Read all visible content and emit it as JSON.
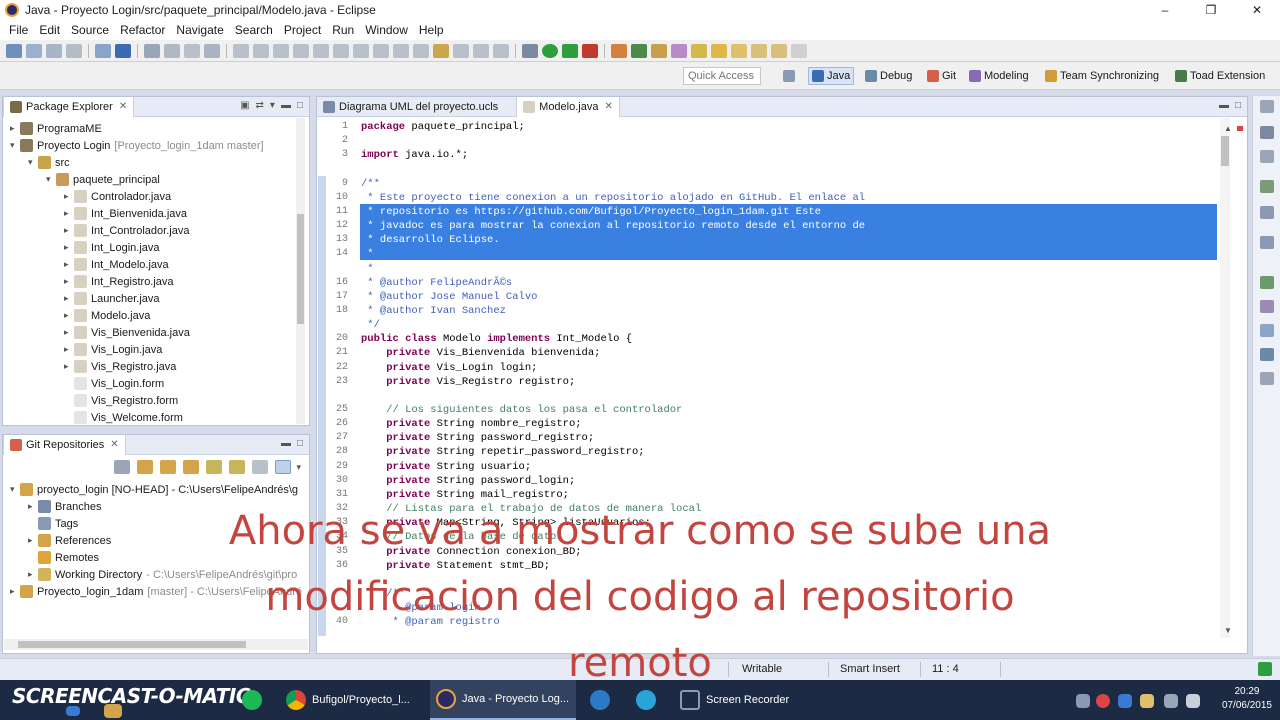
{
  "window": {
    "title": "Java - Proyecto Login/src/paquete_principal/Modelo.java - Eclipse"
  },
  "menu": [
    "File",
    "Edit",
    "Source",
    "Refactor",
    "Navigate",
    "Search",
    "Project",
    "Run",
    "Window",
    "Help"
  ],
  "quick_access": {
    "placeholder": "Quick Access"
  },
  "perspectives": [
    {
      "label": "Java",
      "active": true
    },
    {
      "label": "Debug"
    },
    {
      "label": "Git"
    },
    {
      "label": "Modeling"
    },
    {
      "label": "Team Synchronizing"
    },
    {
      "label": "Toad Extension"
    }
  ],
  "package_explorer": {
    "title": "Package Explorer",
    "items": [
      {
        "label": "ProgramaME"
      },
      {
        "label": "Proyecto Login",
        "detail": "[Proyecto_login_1dam master]"
      },
      {
        "label": "src"
      },
      {
        "label": "paquete_principal"
      },
      {
        "label": "Controlador.java"
      },
      {
        "label": "Int_Bienvenida.java"
      },
      {
        "label": "Int_Controlador.java"
      },
      {
        "label": "Int_Login.java"
      },
      {
        "label": "Int_Modelo.java"
      },
      {
        "label": "Int_Registro.java"
      },
      {
        "label": "Launcher.java"
      },
      {
        "label": "Modelo.java"
      },
      {
        "label": "Vis_Bienvenida.java"
      },
      {
        "label": "Vis_Login.java"
      },
      {
        "label": "Vis_Registro.java"
      },
      {
        "label": "Vis_Login.form"
      },
      {
        "label": "Vis_Registro.form"
      },
      {
        "label": "Vis_Welcome.form"
      }
    ]
  },
  "git_repositories": {
    "title": "Git Repositories",
    "items": [
      {
        "label": "proyecto_login [NO-HEAD] - C:\\Users\\FelipeAndrés\\g"
      },
      {
        "label": "Branches"
      },
      {
        "label": "Tags"
      },
      {
        "label": "References"
      },
      {
        "label": "Remotes"
      },
      {
        "label": "Working Directory",
        "detail": "- C:\\Users\\FelipeAndrés\\git\\pro"
      },
      {
        "label": "Proyecto_login_1dam",
        "detail": "[master] - C:\\Users\\FelipeAndré"
      }
    ]
  },
  "editor": {
    "tabs": [
      {
        "label": "Diagrama UML del proyecto.ucls"
      },
      {
        "label": "Modelo.java",
        "active": true
      }
    ],
    "line_numbers": [
      "1",
      "2",
      "3",
      "",
      "9",
      "10",
      "11",
      "12",
      "13",
      "14",
      "",
      "16",
      "17",
      "18",
      "",
      "20",
      "21",
      "22",
      "23",
      "",
      "25",
      "26",
      "27",
      "28",
      "29",
      "30",
      "31",
      "32",
      "33",
      "34",
      "35",
      "36",
      "",
      "",
      "",
      "40"
    ],
    "lines": [
      "package paquete_principal;",
      "",
      "import java.io.*;",
      "",
      "/**",
      " * Este proyecto tiene conexion a un repositorio alojado en GitHub. El enlace al",
      " * repositorio es https://github.com/Bufigol/Proyecto_login_1dam.git Este",
      " * javadoc es para mostrar la conexion al repositorio remoto desde el entorno de",
      " * desarrollo Eclipse.",
      " *",
      " *",
      " * @author FelipeAndrÃ©s",
      " * @author Jose Manuel Calvo",
      " * @author Ivan Sanchez",
      " */",
      "public class Modelo implements Int_Modelo {",
      "    private Vis_Bienvenida bienvenida;",
      "    private Vis_Login login;",
      "    private Vis_Registro registro;",
      "",
      "    // Los siguientes datos los pasa el controlador",
      "    private String nombre_registro;",
      "    private String password_registro;",
      "    private String repetir_password_registro;",
      "    private String usuario;",
      "    private String password_login;",
      "    private String mail_registro;",
      "    // Listas para el trabajo de datos de manera local",
      "    private Map<String, String> listaUsuarios;",
      "    // Datos de la base de datos",
      "    private Connection conexion_BD;",
      "    private Statement stmt_BD;",
      "",
      "    /**",
      "     * @param login",
      "     * @param registro"
    ]
  },
  "status": {
    "mode": "Writable",
    "insert": "Smart Insert",
    "position": "11 : 4"
  },
  "taskbar": {
    "logo": "SCREENCAST-O-MATIC",
    "apps": [
      {
        "label": "Bufigol/Proyecto_l..."
      },
      {
        "label": "Java - Proyecto Log...",
        "active": true
      },
      {
        "label": "Screen Recorder"
      }
    ],
    "time": "20:29",
    "date": "07/06/2015"
  },
  "subtitle": {
    "line1": "Ahora se va a mostrar como se sube una",
    "line2": "modificacion del codigo al repositorio",
    "line3": "remoto"
  }
}
